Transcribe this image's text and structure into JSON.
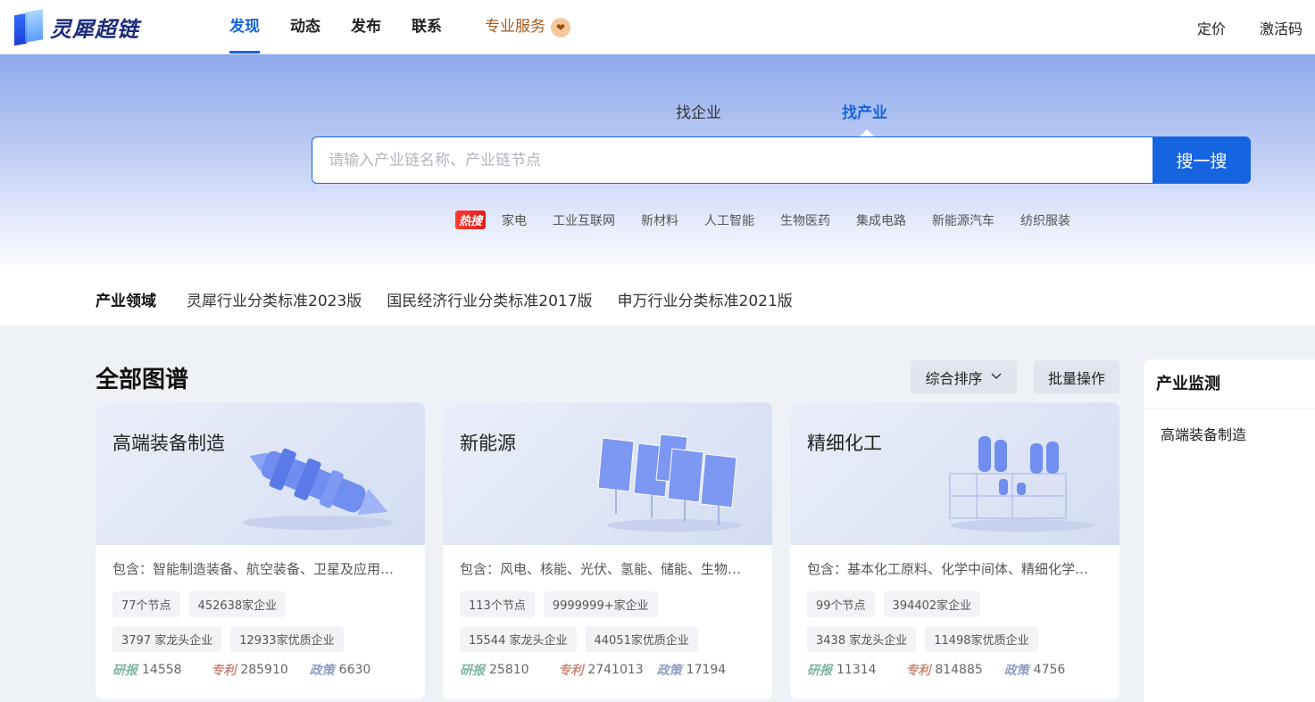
{
  "brand": {
    "name": "灵犀超链"
  },
  "nav": {
    "items": [
      "发现",
      "动态",
      "发布",
      "联系"
    ],
    "pro": "专业服务",
    "pro_icon": "heart-badge-icon",
    "right": [
      "定价",
      "激活码"
    ]
  },
  "search": {
    "tabs": [
      "找企业",
      "找产业"
    ],
    "active_tab": "找产业",
    "placeholder": "请输入产业链名称、产业链节点",
    "button": "搜一搜",
    "hot_label": "热搜",
    "hot_items": [
      "家电",
      "工业互联网",
      "新材料",
      "人工智能",
      "生物医药",
      "集成电路",
      "新能源汽车",
      "纺织服装"
    ]
  },
  "classification": {
    "label": "产业领域",
    "items": [
      "灵犀行业分类标准2023版",
      "国民经济行业分类标准2017版",
      "申万行业分类标准2021版"
    ]
  },
  "main": {
    "title": "全部图谱",
    "sort_label": "综合排序",
    "batch_label": "批量操作",
    "cards": [
      {
        "title": "高端装备制造",
        "desc": "包含：智能制造装备、航空装备、卫星及应用…",
        "nodes": "77个节点",
        "companies": "452638家企业",
        "leaders": "3797 家龙头企业",
        "quality": "12933家优质企业",
        "reports_label": "研报",
        "reports": "14558",
        "patents_label": "专利",
        "patents": "285910",
        "policies_label": "政策",
        "policies": "6630"
      },
      {
        "title": "新能源",
        "desc": "包含：风电、核能、光伏、氢能、储能、生物…",
        "nodes": "113个节点",
        "companies": "9999999+家企业",
        "leaders": "15544 家龙头企业",
        "quality": "44051家优质企业",
        "reports_label": "研报",
        "reports": "25810",
        "patents_label": "专利",
        "patents": "2741013",
        "policies_label": "政策",
        "policies": "17194"
      },
      {
        "title": "精细化工",
        "desc": "包含：基本化工原料、化学中间体、精细化学…",
        "nodes": "99个节点",
        "companies": "394402家企业",
        "leaders": "3438 家龙头企业",
        "quality": "11498家优质企业",
        "reports_label": "研报",
        "reports": "11314",
        "patents_label": "专利",
        "patents": "814885",
        "policies_label": "政策",
        "policies": "4756"
      }
    ]
  },
  "side": {
    "title": "产业监测",
    "items": [
      "高端装备制造"
    ]
  },
  "colors": {
    "accent": "#1565e0",
    "pro": "#a45a1e",
    "hot": "#e01d1d"
  }
}
